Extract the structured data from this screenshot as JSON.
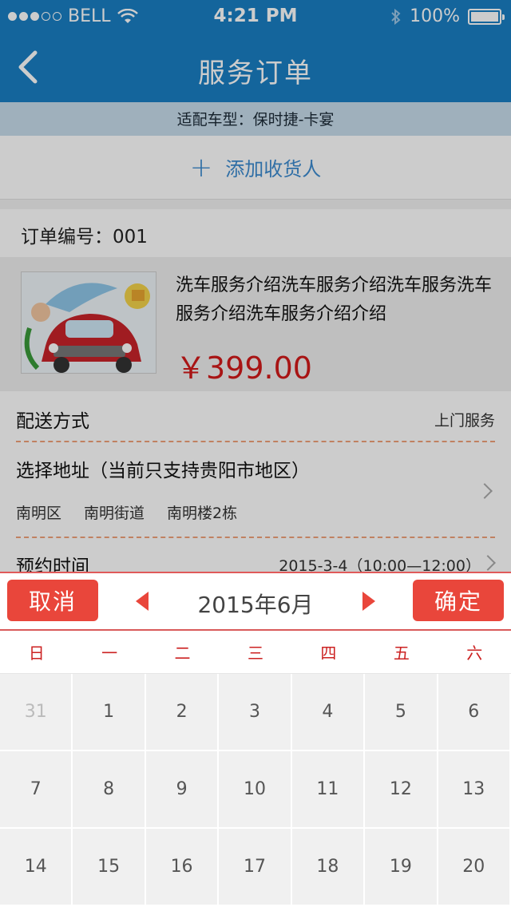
{
  "status": {
    "carrier": "BELL",
    "time": "4:21 PM",
    "battery": "100%",
    "battery_level": 1.0
  },
  "nav": {
    "title": "服务订单"
  },
  "fit": {
    "text": "适配车型：保时捷-卡宴"
  },
  "add": {
    "label": "添加收货人"
  },
  "order": {
    "number_label": "订单编号：001",
    "product_desc": "洗车服务介绍洗车服务介绍洗车服务洗车服务介绍洗车服务介绍介绍",
    "price": "￥399.00"
  },
  "delivery": {
    "label": "配送方式",
    "value": "上门服务"
  },
  "address": {
    "label": "选择地址（当前只支持贵阳市地区）",
    "district": "南明区",
    "street": "南明街道",
    "building": "南明楼2栋"
  },
  "appointment": {
    "label": "预约时间",
    "value": "2015-3-4（10:00—12:00）"
  },
  "picker": {
    "cancel": "取消",
    "confirm": "确定",
    "month": "2015年6月",
    "weekdays": [
      "日",
      "一",
      "二",
      "三",
      "四",
      "五",
      "六"
    ],
    "days": [
      {
        "n": "31",
        "muted": true
      },
      {
        "n": "1"
      },
      {
        "n": "2"
      },
      {
        "n": "3"
      },
      {
        "n": "4"
      },
      {
        "n": "5"
      },
      {
        "n": "6"
      },
      {
        "n": "7"
      },
      {
        "n": "8"
      },
      {
        "n": "9"
      },
      {
        "n": "10"
      },
      {
        "n": "11"
      },
      {
        "n": "12"
      },
      {
        "n": "13"
      },
      {
        "n": "14"
      },
      {
        "n": "15"
      },
      {
        "n": "16"
      },
      {
        "n": "17"
      },
      {
        "n": "18"
      },
      {
        "n": "19"
      },
      {
        "n": "20"
      }
    ]
  }
}
